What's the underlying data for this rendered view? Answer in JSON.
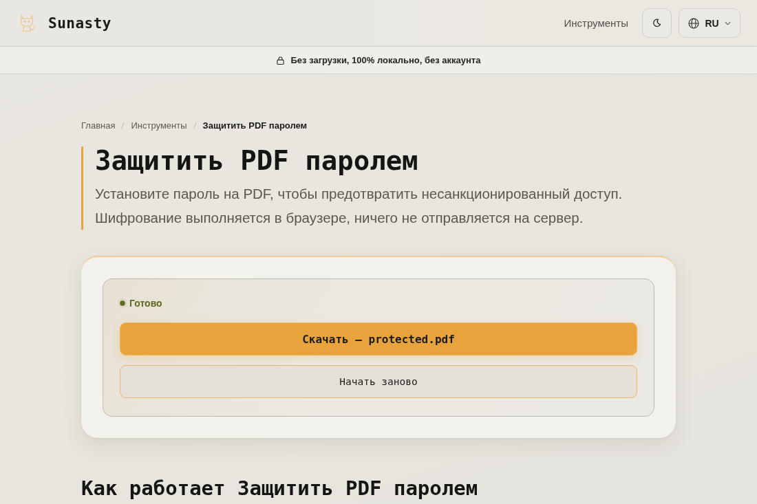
{
  "header": {
    "logo": "Sunasty",
    "nav": [
      {
        "label": "Инструменты"
      }
    ],
    "language": "RU"
  },
  "banner": {
    "text": "Без загрузки, 100% локально, без аккаунта"
  },
  "breadcrumb": [
    {
      "label": "Главная",
      "current": false
    },
    {
      "label": "Инструменты",
      "current": false
    },
    {
      "label": "Защитить PDF паролем",
      "current": true
    }
  ],
  "page": {
    "title": "Защитить PDF паролем",
    "description": "Установите пароль на PDF, чтобы предотвратить несанкционированный доступ. Шифрование выполняется в браузере, ничего не отправляется на сервер."
  },
  "result": {
    "status": "Готово",
    "download": "Скачать — protected.pdf",
    "restart": "Начать заново"
  },
  "section": {
    "title": "Как работает Защитить PDF паролем"
  }
}
